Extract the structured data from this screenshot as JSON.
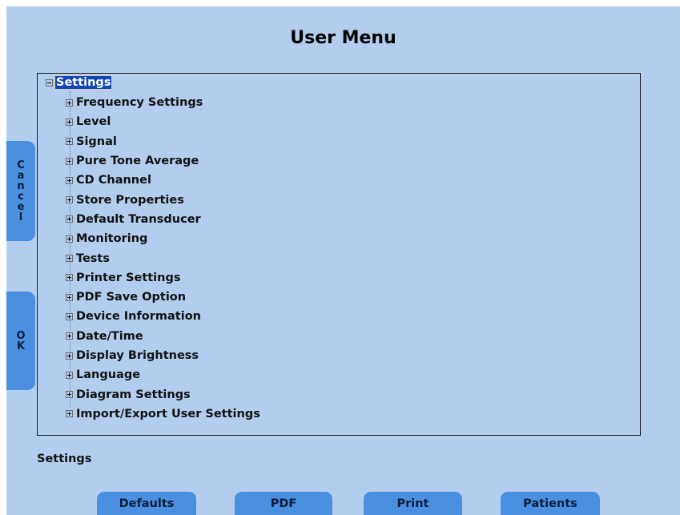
{
  "title": "User Menu",
  "tree": {
    "root_label": "Settings",
    "items": [
      "Frequency Settings",
      "Level",
      "Signal",
      "Pure Tone Average",
      "CD Channel",
      "Store Properties",
      "Default Transducer",
      "Monitoring",
      "Tests",
      "Printer Settings",
      "PDF Save Option",
      "Device Information",
      "Date/Time",
      "Display Brightness",
      "Language",
      "Diagram Settings",
      "Import/Export User Settings"
    ]
  },
  "status_text": "Settings",
  "side_tabs": {
    "cancel_label": "Cancel",
    "ok_label": "OK"
  },
  "bottom_buttons": {
    "defaults_label": "Defaults",
    "pdf_label": "PDF",
    "print_label": "Print",
    "patients_label": "Patients"
  },
  "colors": {
    "background": "#b3cdee",
    "button": "#4a8fe0",
    "selection": "#1245b8"
  },
  "icons": {
    "collapse": "minus-box-icon",
    "expand": "plus-box-icon"
  }
}
